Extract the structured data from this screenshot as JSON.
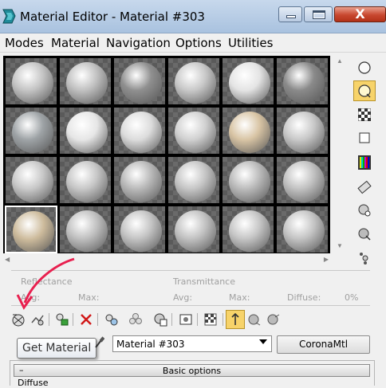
{
  "window": {
    "title": "Material Editor - Material #303",
    "close_glyph": "X"
  },
  "menu": [
    "Modes",
    "Material",
    "Navigation",
    "Options",
    "Utilities"
  ],
  "slots": [
    {
      "tone": "#c4c4c4"
    },
    {
      "tone": "#c0c0c0"
    },
    {
      "tone": "#8f8f8f"
    },
    {
      "tone": "#c8c8c8"
    },
    {
      "tone": "#e4e4e4"
    },
    {
      "tone": "#8a8a8a"
    },
    {
      "tone": "#9ea3a6"
    },
    {
      "tone": "#e6e6e6"
    },
    {
      "tone": "#dcdcdc"
    },
    {
      "tone": "#d0d0d0"
    },
    {
      "tone": "#d8c4a4"
    },
    {
      "tone": "#c8c8c8"
    },
    {
      "tone": "#c8c8c8"
    },
    {
      "tone": "#c6c6c6"
    },
    {
      "tone": "#b8b8b8"
    },
    {
      "tone": "#c4c4c4"
    },
    {
      "tone": "#bababa"
    },
    {
      "tone": "#c0c0c0"
    },
    {
      "tone": "#cdbb9c"
    },
    {
      "tone": "#c0c0c0"
    },
    {
      "tone": "#c4c4c4"
    },
    {
      "tone": "#c2c2c2"
    },
    {
      "tone": "#c6c6c6"
    },
    {
      "tone": "#c4c4c4"
    }
  ],
  "reflectance": {
    "label": "Reflectance",
    "avg": "Avg:",
    "max": "Max:"
  },
  "transmittance": {
    "label": "Transmittance",
    "avg": "Avg:",
    "max": "Max:",
    "diffuse": "Diffuse:",
    "diffuse_value": "0%"
  },
  "tooltip": "Get Material",
  "material_name": "Material #303",
  "material_type": "CoronaMtl",
  "rollout": {
    "collapse": "–",
    "title": "Basic options"
  },
  "diffuse_label": "Diffuse",
  "colors": {
    "accent_active": "#f7d36a",
    "annotation_arrow": "#e8204f",
    "close_button": "#c8472f"
  }
}
